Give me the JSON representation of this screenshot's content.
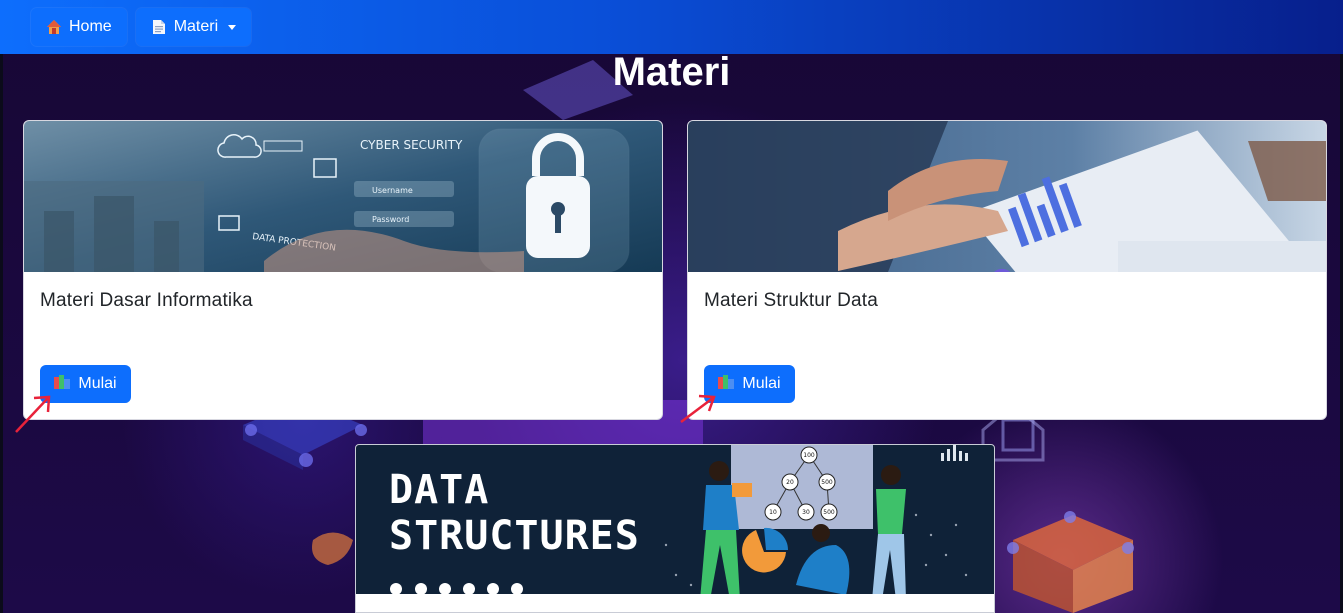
{
  "nav": {
    "home_label": "Home",
    "materi_label": "Materi",
    "home_icon": "house-icon",
    "materi_icon": "document-icon"
  },
  "page": {
    "title": "Materi"
  },
  "cards": [
    {
      "title": "Materi Dasar Informatika",
      "button_label": "Mulai",
      "image_icon": "cyber-security-lock-image",
      "image_texts": [
        "CYBER SECURITY",
        "Username",
        "Password",
        "DATA PROTECTION"
      ]
    },
    {
      "title": "Materi Struktur Data",
      "button_label": "Mulai",
      "image_icon": "tablet-analytics-image"
    }
  ],
  "banner": {
    "line1": "DATA",
    "line2": "STRUCTURES",
    "tree_nodes": [
      "100",
      "20",
      "500",
      "10",
      "30",
      "500"
    ]
  },
  "colors": {
    "primary": "#0d6efd",
    "background": "#1b0a40",
    "arrow": "#e8223a"
  }
}
